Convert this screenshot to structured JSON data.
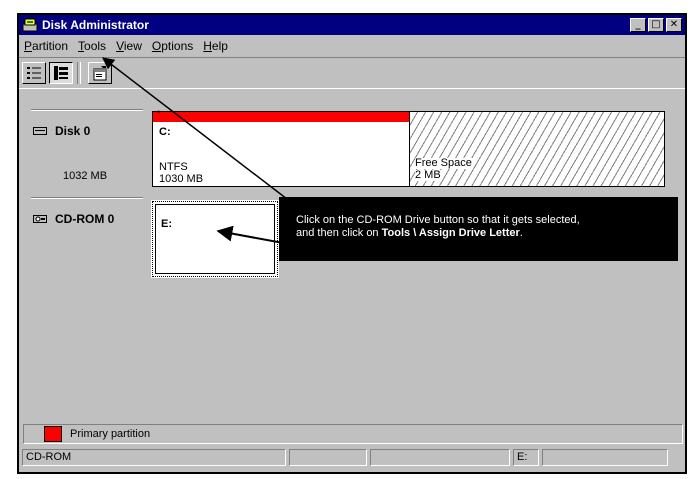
{
  "window": {
    "title": "Disk Administrator",
    "controls": [
      "minimize",
      "maximize",
      "close"
    ],
    "control_glyphs": {
      "minimize": "_",
      "maximize": "□",
      "close": "✕"
    }
  },
  "menubar": {
    "items": [
      {
        "label": "Partition",
        "accel": "P",
        "rest": "artition"
      },
      {
        "label": "Tools",
        "accel": "T",
        "rest": "ools"
      },
      {
        "label": "View",
        "accel": "V",
        "rest": "iew"
      },
      {
        "label": "Options",
        "accel": "O",
        "rest": "ptions"
      },
      {
        "label": "Help",
        "accel": "H",
        "rest": "elp"
      }
    ]
  },
  "toolbar": {
    "buttons": [
      "volumes-view-icon",
      "disk-config-view-icon",
      "properties-icon"
    ]
  },
  "disks": [
    {
      "label": "Disk 0",
      "size": "1032 MB",
      "icon": "hard-disk-icon",
      "partitions": [
        {
          "letter": "C:",
          "fs": "NTFS",
          "size": "1030 MB",
          "type": "primary",
          "marker": "*"
        },
        {
          "letter": "",
          "fs": "Free Space",
          "size": "2 MB",
          "type": "free"
        }
      ]
    },
    {
      "label": "CD-ROM 0",
      "icon": "cdrom-icon",
      "partitions": [
        {
          "letter": "E:",
          "selected": true
        }
      ]
    }
  ],
  "legend": {
    "primary_label": "Primary partition",
    "primary_color": "#ff0000"
  },
  "statusbar": {
    "cells": [
      "CD-ROM",
      "",
      "",
      "E:",
      ""
    ]
  },
  "callout": {
    "line1": "Click on the CD-ROM Drive button so that it gets selected,",
    "line2_prefix": "and then click on ",
    "line2_bold": "Tools \\ Assign Drive Letter",
    "line2_suffix": "."
  },
  "colors": {
    "title_bar": "#000080",
    "window_face": "#c0c0c0",
    "primary": "#ff0000"
  }
}
